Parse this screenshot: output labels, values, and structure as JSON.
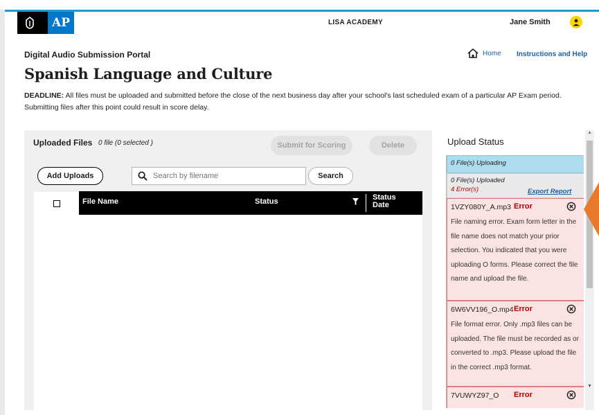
{
  "header": {
    "logo_text": "AP",
    "academy": "LISA ACADEMY",
    "user_name": "Jane Smith"
  },
  "page": {
    "portal_title": "Digital Audio Submission Portal",
    "home_link": "Home",
    "help_link": "Instructions and Help",
    "title": "Spanish Language and Culture",
    "deadline_label": "DEADLINE:",
    "deadline_text": " All files must be uploaded and submitted before the close of the next business day after your school's last scheduled exam of a particular AP Exam period. Submitting files after this point could result in score delay."
  },
  "files": {
    "title": "Uploaded Files",
    "count": "0 file (0 selected )",
    "submit_label": "Submit for Scoring",
    "delete_label": "Delete",
    "add_label": "Add Uploads",
    "search_placeholder": "Search by filename",
    "search_label": "Search",
    "columns": {
      "file_name": "File Name",
      "status": "Status",
      "status_date": "Status Date"
    }
  },
  "upload_status": {
    "title": "Upload Status",
    "uploading": "0 File(s) Uploading",
    "uploaded": "0 File(s) Uploaded",
    "errors": "4 Error(s)",
    "export_label": "Export Report",
    "items": [
      {
        "file": "1VZY080Y_A.mp3",
        "status": "Error",
        "message": "File naming error. Exam form letter in the file name does not match your prior selection. You indicated that you were uploading O forms. Please correct the file name and upload the file."
      },
      {
        "file": "6W6VV196_O.mp4",
        "status": "Error",
        "message": "File format error. Only .mp3 files can be uploaded. The file must be recorded as or converted to .mp3. Please upload the file in the correct .mp3 format."
      },
      {
        "file": "7VUWYZ97_O",
        "status": "Error",
        "message": ""
      }
    ]
  },
  "colors": {
    "accent_blue": "#1e9bd7",
    "error_red": "#b40000",
    "error_bg": "#fbe3e3",
    "uploading_bg": "#acdcee",
    "avatar_yellow": "#ffd400",
    "pointer_orange": "#e8782a"
  },
  "icons": {
    "logo": "acorn-icon",
    "home": "home-icon",
    "search": "search-icon",
    "filter": "filter-icon",
    "close": "close-circle-icon",
    "user": "user-avatar-icon"
  }
}
